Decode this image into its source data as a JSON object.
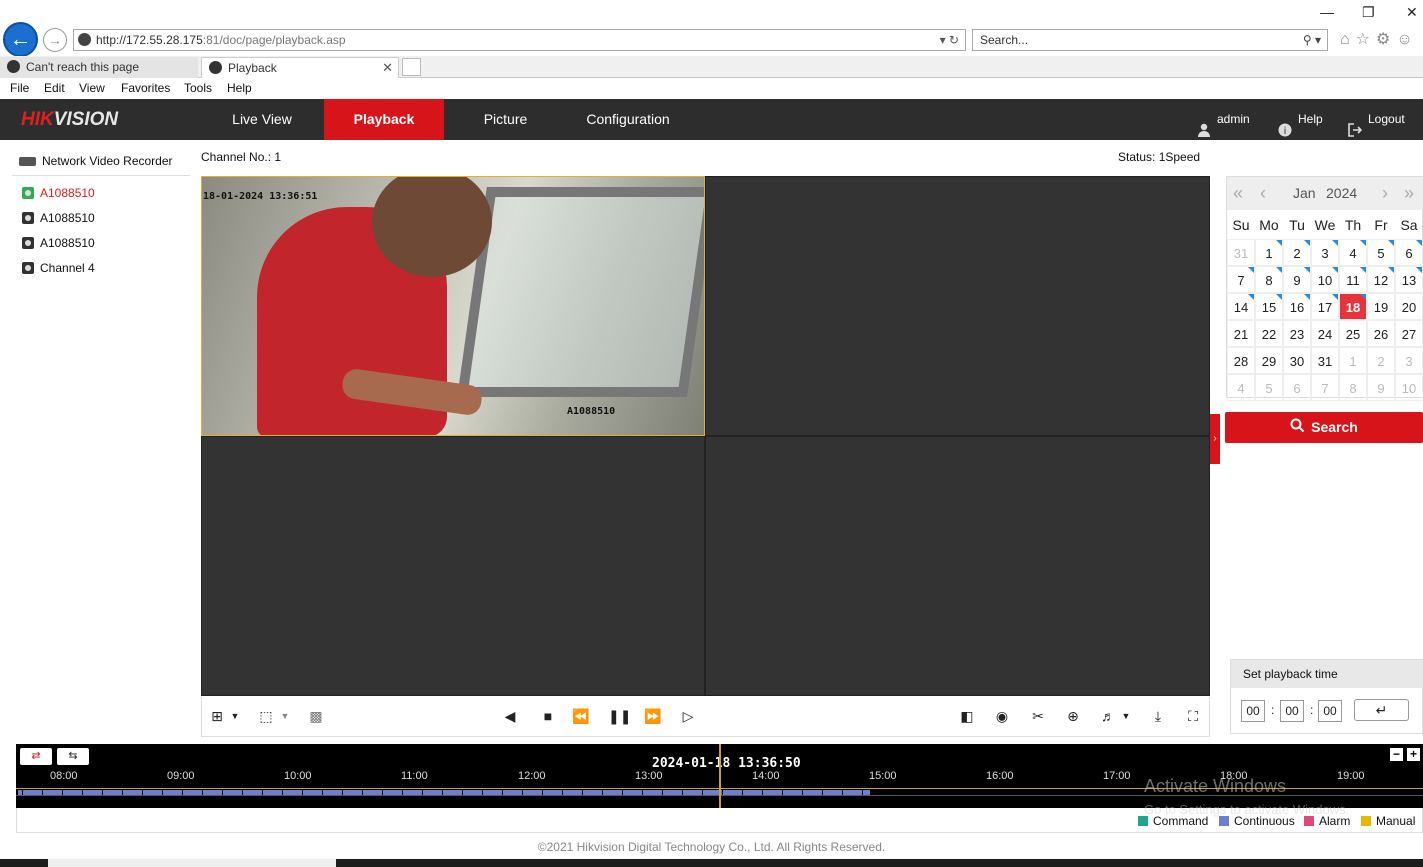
{
  "browser": {
    "url_prefix": "http://",
    "url_host": "172.55.28.175",
    "url_rest": ":81/doc/page/playback.asp",
    "search_placeholder": "Search...",
    "tabs": [
      {
        "label": "Can't reach this page"
      },
      {
        "label": "Playback"
      }
    ],
    "menu": [
      "File",
      "Edit",
      "View",
      "Favorites",
      "Tools",
      "Help"
    ]
  },
  "header": {
    "logo_red": "HIK",
    "logo_white": "VISION",
    "nav": [
      "Live View",
      "Playback",
      "Picture",
      "Configuration"
    ],
    "active_nav": "Playback",
    "user": "admin",
    "help": "Help",
    "logout": "Logout",
    "accent_color": "#d7141a"
  },
  "tree": {
    "title": "Network Video Recorder",
    "channels": [
      {
        "label": "A1088510",
        "selected": true
      },
      {
        "label": "A1088510",
        "selected": false
      },
      {
        "label": "A1088510",
        "selected": false
      },
      {
        "label": "Channel 4",
        "selected": false
      }
    ]
  },
  "viewer": {
    "channel_no": "Channel No.: 1",
    "status": "Status: 1Speed",
    "osd_time": "18-01-2024 13:36:51",
    "osd_name": "A1088510"
  },
  "calendar": {
    "month": "Jan",
    "year": "2024",
    "weekdays": [
      "Su",
      "Mo",
      "Tu",
      "We",
      "Th",
      "Fr",
      "Sa"
    ],
    "days": [
      [
        "31",
        "1",
        "2",
        "3",
        "4",
        "5",
        "6"
      ],
      [
        "7",
        "8",
        "9",
        "10",
        "11",
        "12",
        "13"
      ],
      [
        "14",
        "15",
        "16",
        "17",
        "18",
        "19",
        "20"
      ],
      [
        "21",
        "22",
        "23",
        "24",
        "25",
        "26",
        "27"
      ],
      [
        "28",
        "29",
        "30",
        "31",
        "1",
        "2",
        "3"
      ],
      [
        "4",
        "5",
        "6",
        "7",
        "8",
        "9",
        "10"
      ]
    ],
    "today": "18",
    "search_label": "Search"
  },
  "set_time": {
    "title": "Set playback time",
    "hh": "00",
    "mm": "00",
    "ss": "00"
  },
  "timeline": {
    "current": "2024-01-18 13:36:50",
    "hours": [
      "08:00",
      "09:00",
      "10:00",
      "11:00",
      "12:00",
      "13:00",
      "14:00",
      "15:00",
      "16:00",
      "17:00",
      "18:00",
      "19:00"
    ]
  },
  "legend": [
    {
      "label": "Command",
      "color": "#1fa68e"
    },
    {
      "label": "Continuous",
      "color": "#6b7fd6"
    },
    {
      "label": "Alarm",
      "color": "#e0487a"
    },
    {
      "label": "Manual",
      "color": "#e6b800"
    }
  ],
  "watermark": {
    "line1": "Activate Windows",
    "line2": "Go to Settings to activate Windows."
  },
  "footer": "©2021 Hikvision Digital Technology Co., Ltd. All Rights Reserved."
}
